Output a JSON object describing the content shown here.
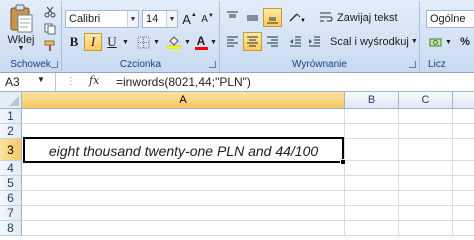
{
  "ribbon": {
    "clipboard": {
      "paste_label": "Wklej",
      "group_label": "Schowek"
    },
    "font": {
      "font_name": "Calibri",
      "font_size": "14",
      "group_label": "Czcionka",
      "bold": "B",
      "italic": "I",
      "underline": "U",
      "font_color_glyph": "A",
      "grow_glyph": "A",
      "shrink_glyph": "A"
    },
    "alignment": {
      "wrap_text": "Zawijaj tekst",
      "merge_center": "Scal i wyśrodkuj",
      "group_label": "Wyrównanie"
    },
    "number": {
      "format": "Ogólne",
      "group_label": "Licz"
    },
    "colors": {
      "fill": "#ffff00",
      "font": "#ff0000"
    }
  },
  "formula_bar": {
    "name_box": "A3",
    "fx": "fx",
    "formula": "=inwords(8021,44;\"PLN\")"
  },
  "grid": {
    "columns": [
      "A",
      "B",
      "C"
    ],
    "rows": [
      "1",
      "2",
      "3",
      "4",
      "5",
      "6",
      "7",
      "8"
    ],
    "active_cell": "A3",
    "cell_A3": "eight thousand twenty-one PLN and 44/100"
  }
}
